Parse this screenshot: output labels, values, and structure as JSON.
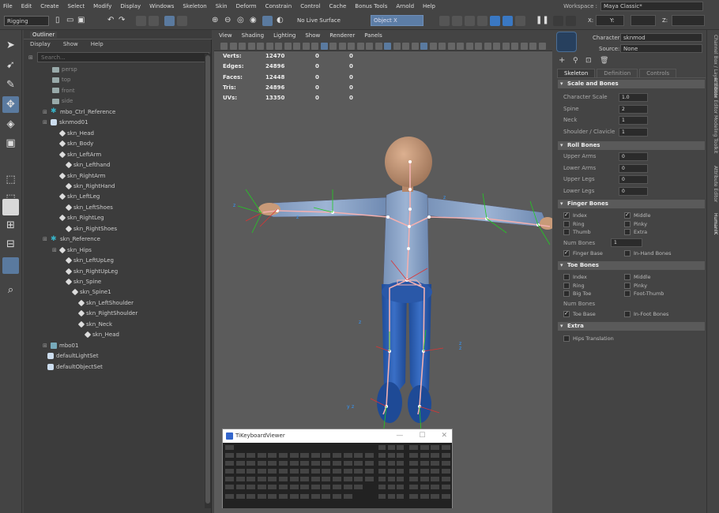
{
  "menubar": {
    "items": [
      "File",
      "Edit",
      "Create",
      "Select",
      "Modify",
      "Display",
      "Windows",
      "Skeleton",
      "Skin",
      "Deform",
      "Constrain",
      "Control",
      "Cache",
      "Bonus Tools",
      "Arnold",
      "Help"
    ],
    "workspace_label": "Workspace :",
    "workspace_value": "Maya Classic*"
  },
  "toolbar": {
    "mode": "Rigging",
    "live_surface": "No Live Surface",
    "object_field": "Object X",
    "coord_x_label": "X:",
    "coord_y_label": "Y:",
    "coord_z_label": "Z:"
  },
  "outliner": {
    "title": "Outliner",
    "menu": [
      "Display",
      "Show",
      "Help"
    ],
    "search_placeholder": "Search...",
    "items": [
      {
        "label": "persp",
        "icon": "camera-icon"
      },
      {
        "label": "top",
        "icon": "camera-icon"
      },
      {
        "label": "front",
        "icon": "camera-icon"
      },
      {
        "label": "side",
        "icon": "camera-icon"
      },
      {
        "label": "mbo_Ctrl_Reference",
        "icon": "reference-icon"
      },
      {
        "label": "sknmod01",
        "icon": "character-icon"
      },
      {
        "label": "skn_Head",
        "icon": "effector-icon"
      },
      {
        "label": "skn_Body",
        "icon": "effector-icon"
      },
      {
        "label": "skn_LeftArm",
        "icon": "effector-icon"
      },
      {
        "label": "skn_Lefthand",
        "icon": "effector-icon"
      },
      {
        "label": "skn_RightArm",
        "icon": "effector-icon"
      },
      {
        "label": "skn_RightHand",
        "icon": "effector-icon"
      },
      {
        "label": "skn_LeftLeg",
        "icon": "effector-icon"
      },
      {
        "label": "skn_LeftShoes",
        "icon": "effector-icon"
      },
      {
        "label": "skn_RightLeg",
        "icon": "effector-icon"
      },
      {
        "label": "skn_RightShoes",
        "icon": "effector-icon"
      },
      {
        "label": "skn_Reference",
        "icon": "reference-icon"
      },
      {
        "label": "skn_Hips",
        "icon": "joint-icon"
      },
      {
        "label": "skn_LeftUpLeg",
        "icon": "joint-icon"
      },
      {
        "label": "skn_RightUpLeg",
        "icon": "joint-icon"
      },
      {
        "label": "skn_Spine",
        "icon": "joint-icon"
      },
      {
        "label": "skn_Spine1",
        "icon": "joint-icon"
      },
      {
        "label": "skn_LeftShoulder",
        "icon": "joint-icon"
      },
      {
        "label": "skn_RightShoulder",
        "icon": "joint-icon"
      },
      {
        "label": "skn_Neck",
        "icon": "joint-icon"
      },
      {
        "label": "skn_Head",
        "icon": "joint-icon"
      },
      {
        "label": "mbo01",
        "icon": "group-icon"
      },
      {
        "label": "defaultLightSet",
        "icon": "set-icon"
      },
      {
        "label": "defaultObjectSet",
        "icon": "set-icon"
      }
    ]
  },
  "viewport": {
    "menu": [
      "View",
      "Shading",
      "Lighting",
      "Show",
      "Renderer",
      "Panels"
    ],
    "hud": [
      {
        "label": "Verts:",
        "a": "12470",
        "b": "0",
        "c": "0"
      },
      {
        "label": "Edges:",
        "a": "24896",
        "b": "0",
        "c": "0"
      },
      {
        "label": "Faces:",
        "a": "12448",
        "b": "0",
        "c": "0"
      },
      {
        "label": "Tris:",
        "a": "24896",
        "b": "0",
        "c": "0"
      },
      {
        "label": "UVs:",
        "a": "13350",
        "b": "0",
        "c": "0"
      }
    ],
    "body_color": "#4a6d9e",
    "head_color": "#c89a78",
    "joint_color": "#f0a0a0"
  },
  "kbviewer": {
    "title": "TiKeyboardViewer",
    "minimize": "—",
    "maximize": "☐",
    "close": "✕"
  },
  "hik": {
    "character_label": "Character:",
    "character_value": "sknmod",
    "source_label": "Source:",
    "source_value": "None",
    "tabs": [
      "Skeleton",
      "Definition",
      "Controls"
    ],
    "sections": {
      "scale": {
        "title": "Scale and Bones",
        "rows": [
          {
            "label": "Character Scale",
            "value": "1.0"
          },
          {
            "label": "Spine",
            "value": "2"
          },
          {
            "label": "Neck",
            "value": "1"
          },
          {
            "label": "Shoulder / Clavicle",
            "value": "1"
          }
        ]
      },
      "roll": {
        "title": "Roll Bones",
        "rows": [
          {
            "label": "Upper Arms",
            "value": "0"
          },
          {
            "label": "Lower Arms",
            "value": "0"
          },
          {
            "label": "Upper Legs",
            "value": "0"
          },
          {
            "label": "Lower Legs",
            "value": "0"
          }
        ]
      },
      "finger": {
        "title": "Finger Bones",
        "checks": [
          {
            "label": "Index",
            "on": true
          },
          {
            "label": "Middle",
            "on": true
          },
          {
            "label": "Ring",
            "on": false
          },
          {
            "label": "Pinky",
            "on": false
          },
          {
            "label": "Thumb",
            "on": false
          },
          {
            "label": "Extra",
            "on": false
          }
        ],
        "num_label": "Num Bones",
        "num_value": "1",
        "base": {
          "label": "Finger Base",
          "on": true
        },
        "inhand": {
          "label": "In-Hand Bones",
          "on": false
        }
      },
      "toe": {
        "title": "Toe Bones",
        "checks": [
          {
            "label": "Index",
            "on": false
          },
          {
            "label": "Middle",
            "on": false
          },
          {
            "label": "Ring",
            "on": false
          },
          {
            "label": "Pinky",
            "on": false
          },
          {
            "label": "Big Toe",
            "on": false
          },
          {
            "label": "Foot-Thumb",
            "on": false
          }
        ],
        "num_label": "Num Bones",
        "base": {
          "label": "Toe Base",
          "on": true
        },
        "infoot": {
          "label": "In-Foot Bones",
          "on": false
        }
      },
      "extra": {
        "title": "Extra",
        "hips": {
          "label": "Hips Translation",
          "on": false
        }
      }
    }
  },
  "rightstrip": {
    "tabs": [
      "Channel Box / Layer Editor",
      "Attribute Editor",
      "Modeling Toolkit",
      "Attribute Editor",
      "HumanIK"
    ]
  }
}
